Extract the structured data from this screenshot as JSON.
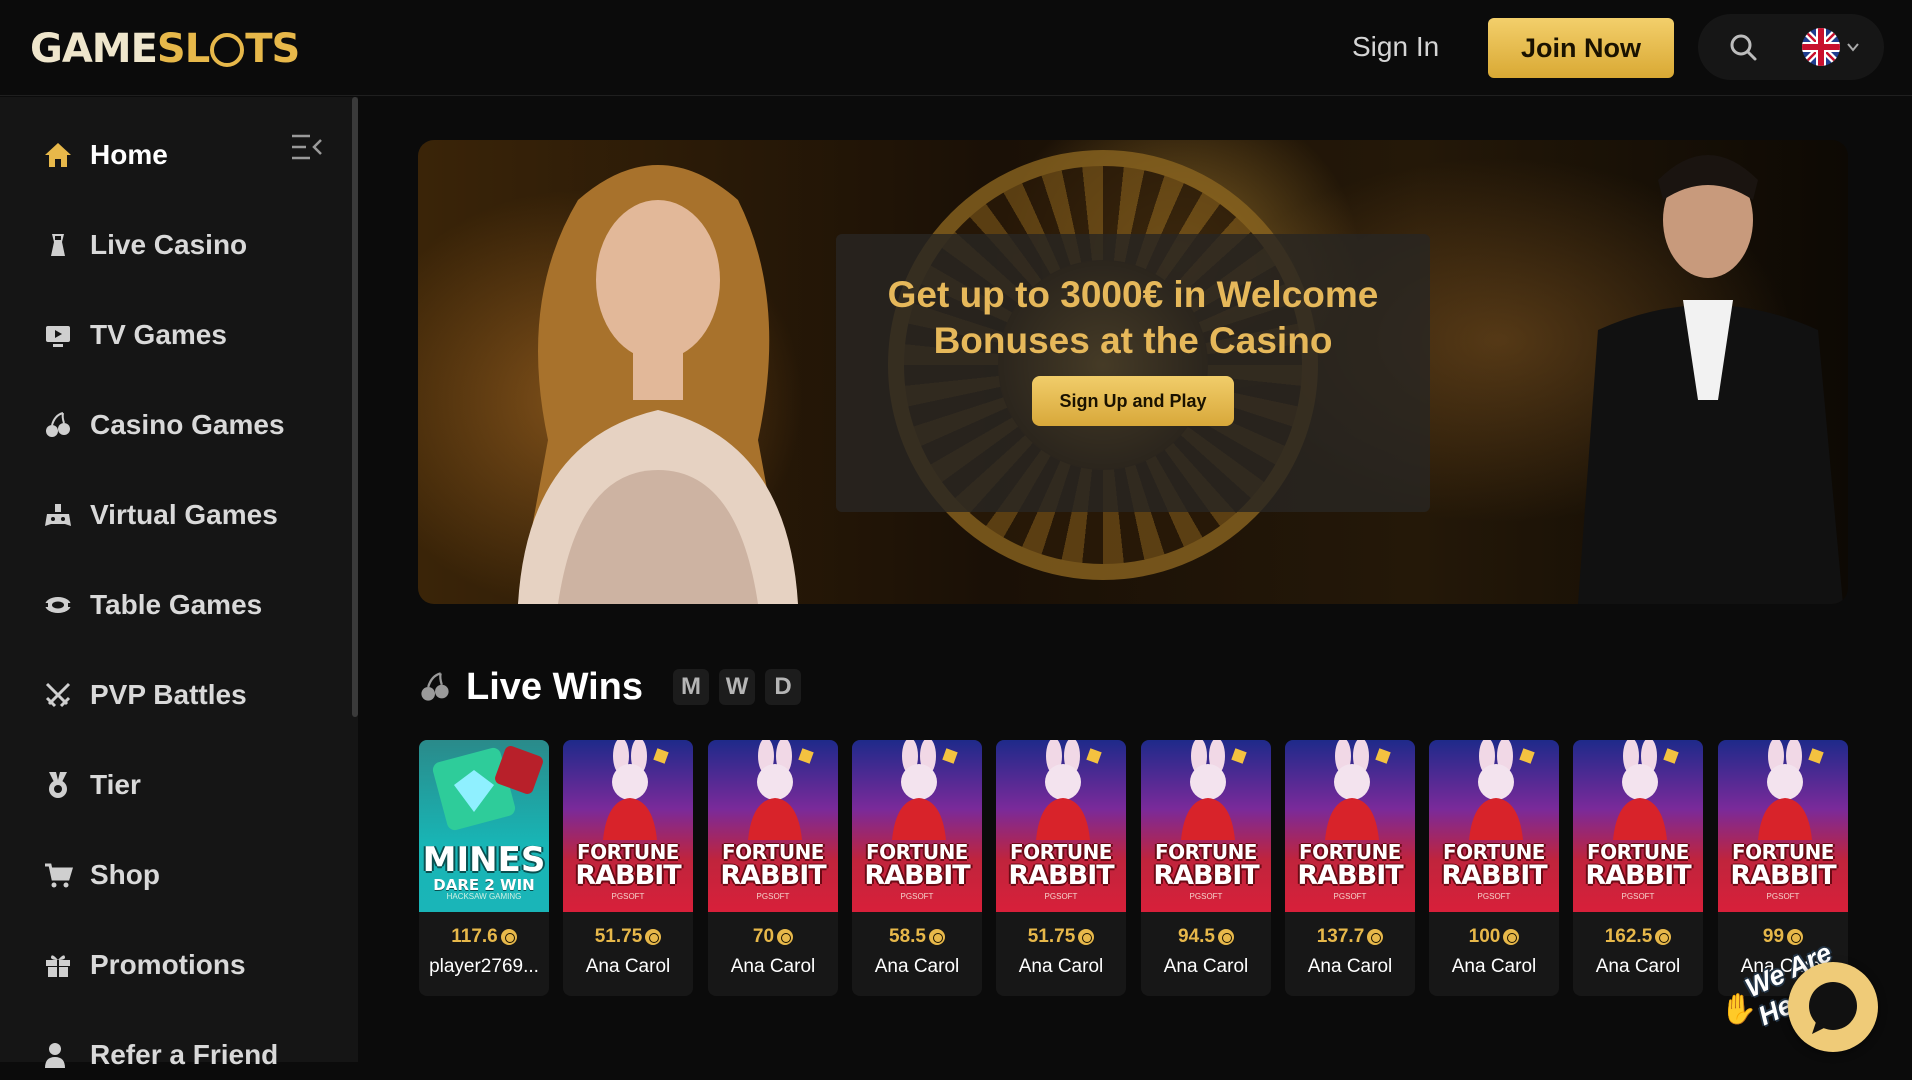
{
  "header": {
    "logo": {
      "part1": "GAME",
      "part2": "SL",
      "part3": "TS"
    },
    "sign_in": "Sign In",
    "join_now": "Join Now",
    "search_icon": "search-icon",
    "language_icon": "uk-flag-icon"
  },
  "sidebar": {
    "items": [
      {
        "label": "Home",
        "icon": "home-icon"
      },
      {
        "label": "Live Casino",
        "icon": "dealer-icon"
      },
      {
        "label": "TV Games",
        "icon": "tv-icon"
      },
      {
        "label": "Casino Games",
        "icon": "cherries-icon"
      },
      {
        "label": "Virtual Games",
        "icon": "gamepad-icon"
      },
      {
        "label": "Table Games",
        "icon": "chip-icon"
      },
      {
        "label": "PVP Battles",
        "icon": "swords-icon"
      },
      {
        "label": "Tier",
        "icon": "medal-icon"
      },
      {
        "label": "Shop",
        "icon": "cart-icon"
      },
      {
        "label": "Promotions",
        "icon": "gift-icon"
      },
      {
        "label": "Refer a Friend",
        "icon": "user-plus-icon"
      }
    ]
  },
  "banner": {
    "title": "Get up to 3000€ in Welcome Bonuses at the Casino",
    "cta": "Sign Up and Play"
  },
  "live_wins": {
    "title": "Live Wins",
    "periods": [
      "M",
      "W",
      "D"
    ],
    "cards": [
      {
        "game": "mines",
        "title1": "MINES",
        "title2": "DARE 2 WIN",
        "studio": "HACKSAW GAMING",
        "amount": "117.6",
        "player": "player2769..."
      },
      {
        "game": "rabbit",
        "title1": "FORTUNE",
        "title2": "RABBIT",
        "studio": "PGSOFT",
        "amount": "51.75",
        "player": "Ana Carol"
      },
      {
        "game": "rabbit",
        "title1": "FORTUNE",
        "title2": "RABBIT",
        "studio": "PGSOFT",
        "amount": "70",
        "player": "Ana Carol"
      },
      {
        "game": "rabbit",
        "title1": "FORTUNE",
        "title2": "RABBIT",
        "studio": "PGSOFT",
        "amount": "58.5",
        "player": "Ana Carol"
      },
      {
        "game": "rabbit",
        "title1": "FORTUNE",
        "title2": "RABBIT",
        "studio": "PGSOFT",
        "amount": "51.75",
        "player": "Ana Carol"
      },
      {
        "game": "rabbit",
        "title1": "FORTUNE",
        "title2": "RABBIT",
        "studio": "PGSOFT",
        "amount": "94.5",
        "player": "Ana Carol"
      },
      {
        "game": "rabbit",
        "title1": "FORTUNE",
        "title2": "RABBIT",
        "studio": "PGSOFT",
        "amount": "137.7",
        "player": "Ana Carol"
      },
      {
        "game": "rabbit",
        "title1": "FORTUNE",
        "title2": "RABBIT",
        "studio": "PGSOFT",
        "amount": "100",
        "player": "Ana Carol"
      },
      {
        "game": "rabbit",
        "title1": "FORTUNE",
        "title2": "RABBIT",
        "studio": "PGSOFT",
        "amount": "162.5",
        "player": "Ana Carol"
      },
      {
        "game": "rabbit",
        "title1": "FORTUNE",
        "title2": "RABBIT",
        "studio": "PGSOFT",
        "amount": "99",
        "player": "Ana Carol"
      }
    ]
  },
  "chat": {
    "label": "We Are Here!"
  },
  "colors": {
    "accent_gold": "#e7b84a",
    "background": "#0b0b0b",
    "sidebar": "#151515"
  }
}
